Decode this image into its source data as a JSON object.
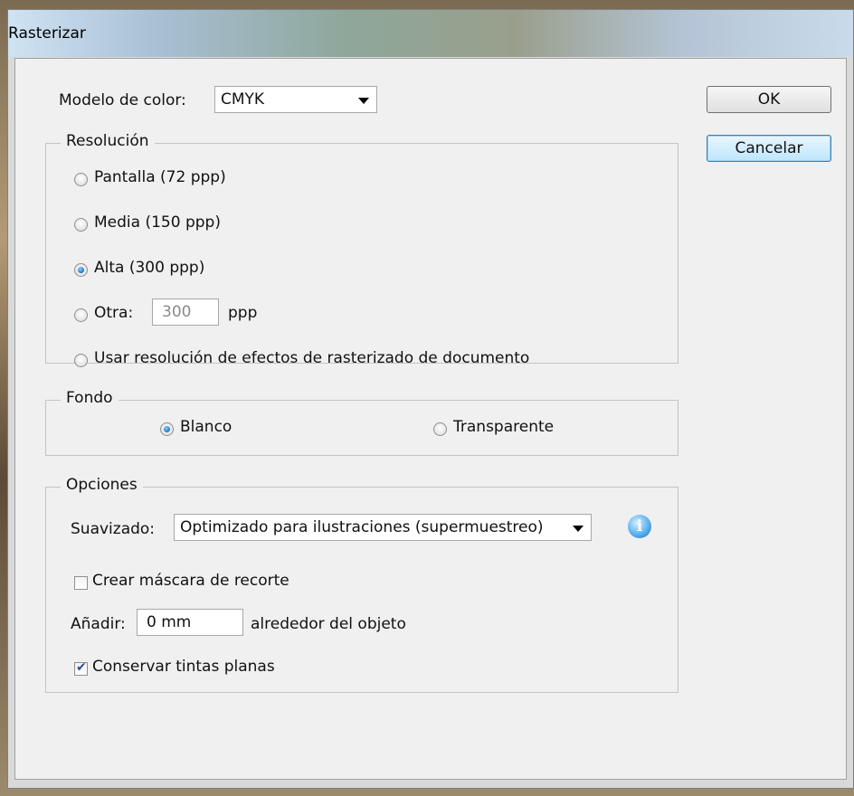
{
  "window": {
    "title": "Rasterizar"
  },
  "color_model": {
    "label": "Modelo de color:",
    "value": "CMYK"
  },
  "buttons": {
    "ok": "OK",
    "cancel": "Cancelar"
  },
  "resolution": {
    "legend": "Resolución",
    "options": [
      {
        "label": "Pantalla (72 ppp)",
        "selected": false
      },
      {
        "label": "Media (150 ppp)",
        "selected": false
      },
      {
        "label": "Alta (300 ppp)",
        "selected": true
      },
      {
        "label": "Otra:",
        "selected": false
      },
      {
        "label": "Usar resolución de efectos de rasterizado de documento",
        "selected": false
      }
    ],
    "other_value": "300",
    "other_unit": "ppp"
  },
  "background": {
    "legend": "Fondo",
    "options": [
      {
        "label": "Blanco",
        "selected": true
      },
      {
        "label": "Transparente",
        "selected": false
      }
    ]
  },
  "options": {
    "legend": "Opciones",
    "antialias_label": "Suavizado:",
    "antialias_value": "Optimizado para ilustraciones (supermuestreo)",
    "clip_mask_label": "Crear máscara de recorte",
    "clip_mask_checked": false,
    "add_label": "Añadir:",
    "add_value": "0 mm",
    "add_suffix": "alrededor del objeto",
    "preserve_label": "Conservar tintas planas",
    "preserve_checked": true
  },
  "icons": {
    "info": "info-icon"
  }
}
